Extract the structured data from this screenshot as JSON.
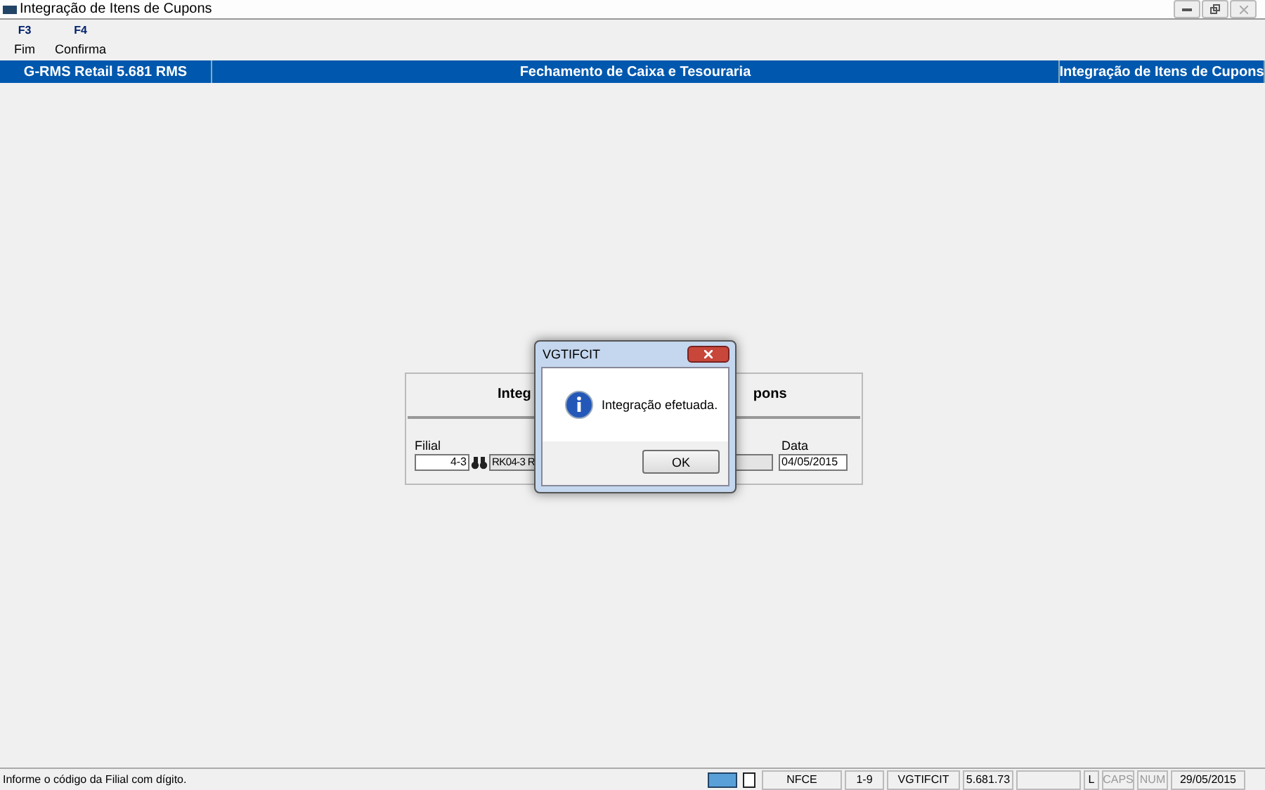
{
  "window": {
    "title": "Integração de Itens de Cupons"
  },
  "toolbar": [
    {
      "key": "F3",
      "label": "Fim"
    },
    {
      "key": "F4",
      "label": "Confirma"
    }
  ],
  "header_bar": [
    "G-RMS Retail 5.681 RMS",
    "Fechamento de Caixa e Tesouraria",
    "Integração de Itens de Cupons"
  ],
  "panel": {
    "title_left": "Integ",
    "title_right": "pons",
    "filial_label": "Filial",
    "filial_value": "4-3",
    "filial_name": "RK04-3 R",
    "data_label": "Data",
    "data_value": "04/05/2015"
  },
  "dialog": {
    "title": "VGTIFCIT",
    "message": "Integração efetuada.",
    "button": "OK"
  },
  "status_bar": {
    "message": "Informe o código da Filial com dígito.",
    "cells": [
      {
        "text": "NFCE",
        "on": true
      },
      {
        "text": "1-9",
        "on": true
      },
      {
        "text": "VGTIFCIT",
        "on": true
      },
      {
        "text": "5.681.73",
        "on": true
      },
      {
        "text": "L",
        "on": true
      },
      {
        "text": "CAPS",
        "on": false
      },
      {
        "text": "NUM",
        "on": false
      },
      {
        "text": "29/05/2015",
        "on": true
      }
    ]
  }
}
